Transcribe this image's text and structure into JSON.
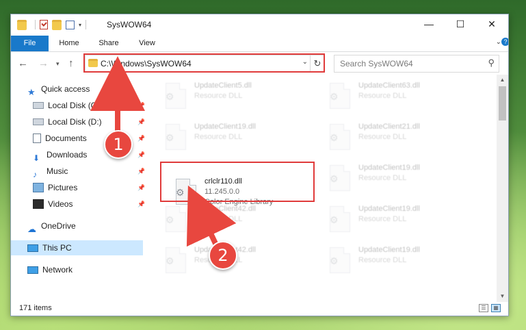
{
  "window": {
    "title": "SysWOW64"
  },
  "title_controls": {
    "minimize": "—",
    "maximize": "☐",
    "close": "✕"
  },
  "ribbon": {
    "tabs": [
      "File",
      "Home",
      "Share",
      "View"
    ]
  },
  "address_bar": {
    "path": "C:\\Windows\\SysWOW64",
    "search_placeholder": "Search SysWOW64"
  },
  "sidebar": {
    "items": [
      {
        "label": "Quick access",
        "icon": "star-icon"
      },
      {
        "label": "Local Disk (C:)",
        "icon": "disk-icon",
        "pinned": true
      },
      {
        "label": "Local Disk (D:)",
        "icon": "disk-icon",
        "pinned": true
      },
      {
        "label": "Documents",
        "icon": "document-icon",
        "pinned": true
      },
      {
        "label": "Downloads",
        "icon": "download-icon",
        "pinned": true
      },
      {
        "label": "Music",
        "icon": "music-icon",
        "pinned": true
      },
      {
        "label": "Pictures",
        "icon": "pictures-icon",
        "pinned": true
      },
      {
        "label": "Videos",
        "icon": "videos-icon",
        "pinned": true
      },
      {
        "label": "OneDrive",
        "icon": "cloud-icon"
      },
      {
        "label": "This PC",
        "icon": "computer-icon",
        "selected": true
      },
      {
        "label": "Network",
        "icon": "network-icon"
      }
    ]
  },
  "files": [
    {
      "name": "UpdateClient5.dll",
      "desc": "Resource DLL"
    },
    {
      "name": "UpdateClient63.dll",
      "desc": "Resource DLL"
    },
    {
      "name": "UpdateClient19.dll",
      "desc": "Resource DLL"
    },
    {
      "name": "UpdateClient21.dll",
      "desc": "Resource DLL"
    },
    {
      "name": "crlclr110.dll",
      "version": "11.245.0.0",
      "desc": "Color Engine Library"
    },
    {
      "name": "UpdateClient19.dll",
      "desc": "Resource DLL"
    },
    {
      "name": "UpdateClient42.dll",
      "desc": "Resource DLL"
    },
    {
      "name": "UpdateClient19.dll",
      "desc": "Resource DLL"
    },
    {
      "name": "UpdateClient42.dll",
      "desc": "Resource DLL"
    },
    {
      "name": "UpdateClient19.dll",
      "desc": "Resource DLL"
    }
  ],
  "status": {
    "item_count": "171 items"
  },
  "annotations": {
    "step1": "1",
    "step2": "2",
    "highlight_color": "#e03a3a"
  }
}
